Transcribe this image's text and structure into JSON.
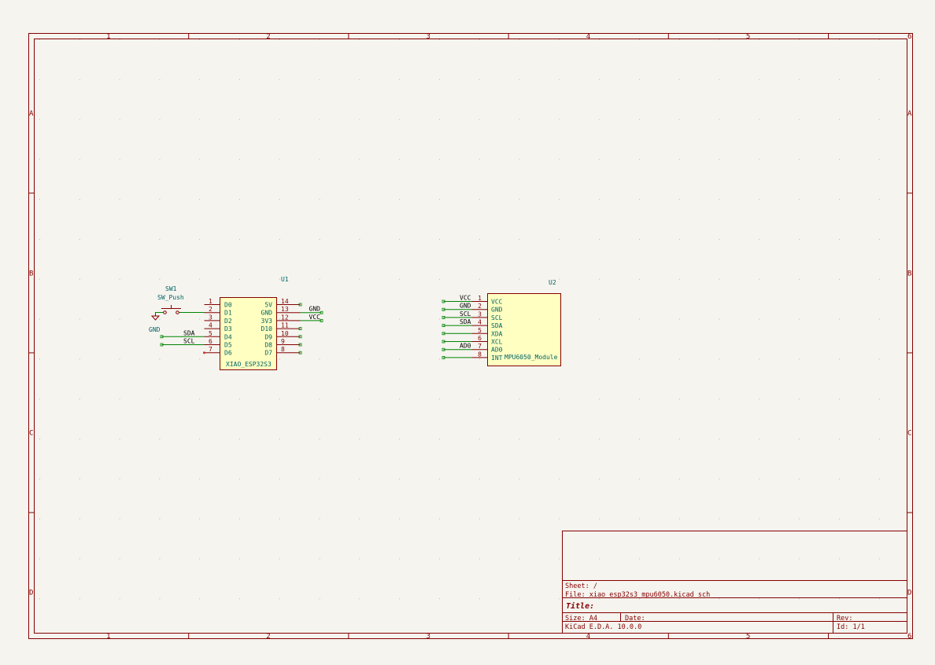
{
  "frame": {
    "columns": [
      "1",
      "2",
      "3",
      "4",
      "5",
      "6"
    ],
    "rows": [
      "A",
      "B",
      "C",
      "D"
    ],
    "border_color": "#840000"
  },
  "u1": {
    "ref": "U1",
    "value": "XIAO_ESP32S3",
    "left_pins": [
      {
        "num": "1",
        "name": "D0",
        "label": ""
      },
      {
        "num": "2",
        "name": "D1",
        "label": ""
      },
      {
        "num": "3",
        "name": "D2",
        "label": ""
      },
      {
        "num": "4",
        "name": "D3",
        "label": ""
      },
      {
        "num": "5",
        "name": "D4",
        "label": "SDA"
      },
      {
        "num": "6",
        "name": "D5",
        "label": "SCL"
      },
      {
        "num": "7",
        "name": "D6",
        "label": ""
      }
    ],
    "right_pins": [
      {
        "num": "14",
        "name": "5V",
        "label": ""
      },
      {
        "num": "13",
        "name": "GND",
        "label": "GND"
      },
      {
        "num": "12",
        "name": "3V3",
        "label": "VCC"
      },
      {
        "num": "11",
        "name": "D10",
        "label": ""
      },
      {
        "num": "10",
        "name": "D9",
        "label": ""
      },
      {
        "num": "9",
        "name": "D8",
        "label": ""
      },
      {
        "num": "8",
        "name": "D7",
        "label": ""
      }
    ]
  },
  "sw1": {
    "ref": "SW1",
    "value": "SW_Push",
    "power": "GND"
  },
  "u2": {
    "ref": "U2",
    "value": "MPU6050_Module",
    "pins": [
      {
        "num": "1",
        "name": "VCC",
        "label": "VCC"
      },
      {
        "num": "2",
        "name": "GND",
        "label": "GND"
      },
      {
        "num": "3",
        "name": "SCL",
        "label": "SCL"
      },
      {
        "num": "4",
        "name": "SDA",
        "label": "SDA"
      },
      {
        "num": "5",
        "name": "XDA",
        "label": ""
      },
      {
        "num": "6",
        "name": "XCL",
        "label": ""
      },
      {
        "num": "7",
        "name": "AD0",
        "label": "AD0"
      },
      {
        "num": "8",
        "name": "INT",
        "label": ""
      }
    ]
  },
  "title_block": {
    "sheet": "Sheet: /",
    "file": "File: xiao_esp32s3_mpu6050.kicad_sch",
    "title": "Title:",
    "size": "Size: A4",
    "date": "Date:",
    "rev": "Rev:",
    "tool": "KiCad E.D.A. 10.0.0",
    "id": "Id: 1/1"
  }
}
